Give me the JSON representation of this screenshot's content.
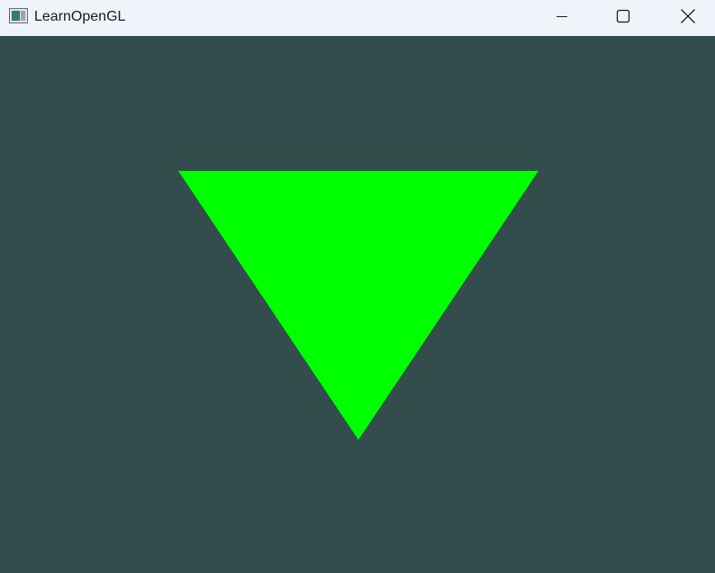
{
  "window": {
    "title": "LearnOpenGL",
    "app_icon": "window-app-icon",
    "controls": {
      "minimize_icon": "minimize-icon",
      "maximize_icon": "maximize-icon",
      "close_icon": "close-icon"
    }
  },
  "scene": {
    "clear_color": "#334d4d",
    "triangle_color": "#00ff00",
    "shape": "inverted triangle"
  },
  "colors": {
    "titlebar_bg": "#eef4f9",
    "title_text": "#1b1b1b"
  }
}
